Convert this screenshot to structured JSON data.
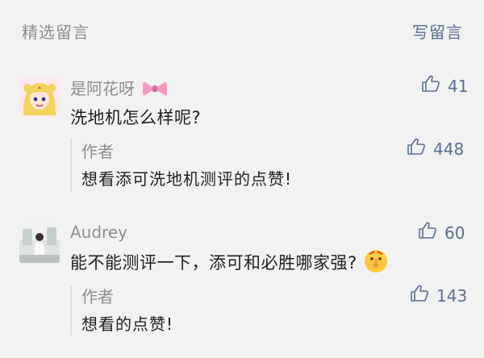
{
  "header": {
    "title": "精选留言",
    "write_label": "写留言"
  },
  "comments": [
    {
      "author": "是阿花呀",
      "text": "洗地机怎么样呢?",
      "likes": "41",
      "reply": {
        "label": "作者",
        "text": "想看添可洗地机测评的点赞!",
        "likes": "448"
      }
    },
    {
      "author": "Audrey",
      "text": "能不能测评一下，添可和必胜哪家强?",
      "likes": "60",
      "reply": {
        "label": "作者",
        "text": "想看的点赞!",
        "likes": "143"
      }
    }
  ],
  "icons": {
    "like": "thumbs-up-icon",
    "name_decoration": "bow-emoji",
    "inline_emoji": "shushing-face-emoji"
  },
  "colors": {
    "link": "#5a6f93",
    "muted": "#8e8e8e",
    "text": "#1f1f1f",
    "background": "#f2f2f2"
  }
}
